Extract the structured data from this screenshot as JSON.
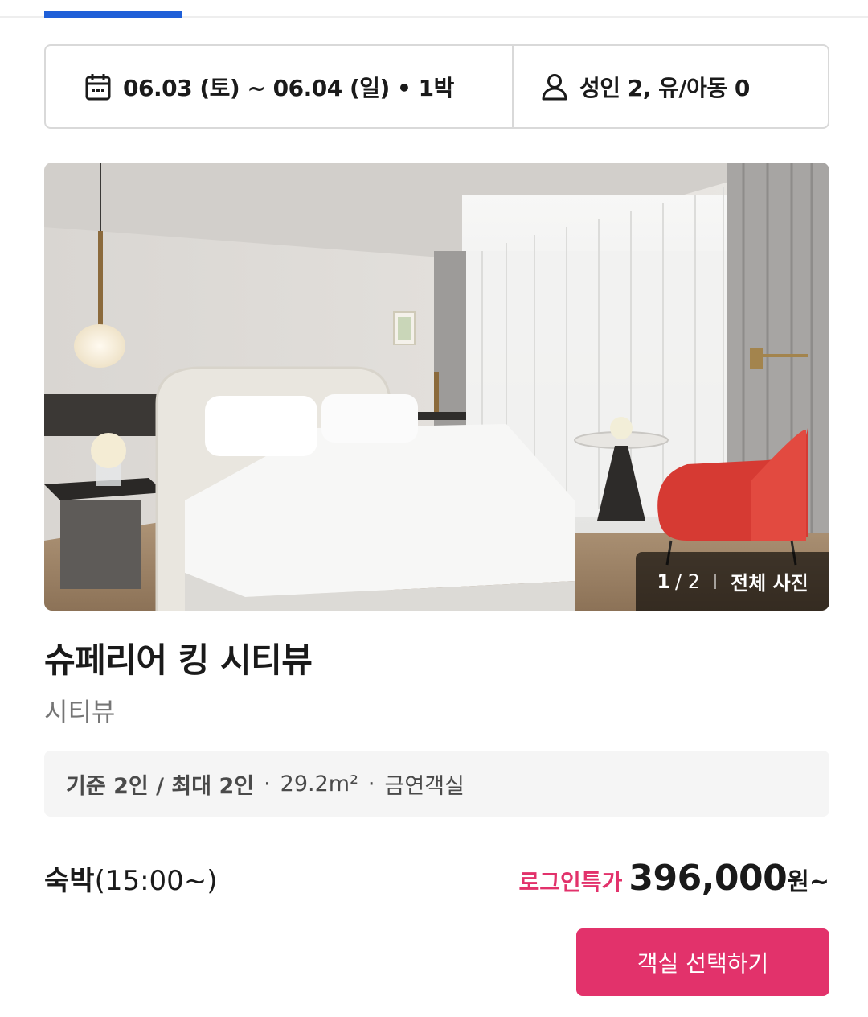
{
  "search": {
    "date_range": "06.03 (토) ~ 06.04 (일) • 1박",
    "guests": "성인 2, 유/아동 0",
    "date_icon": "calendar-icon",
    "guest_icon": "person-icon"
  },
  "photo": {
    "current": "1",
    "total": "/ 2",
    "all_photos_label": "전체 사진"
  },
  "room": {
    "title": "슈페리어 킹 시티뷰",
    "subtitle": "시티뷰",
    "capacity": "기준 2인 / 최대 2인",
    "size": "29.2m²",
    "smoking": "금연객실"
  },
  "stay": {
    "type": "숙박",
    "checkin": "(15:00~)"
  },
  "price": {
    "badge": "로그인특가",
    "amount": "396,000",
    "unit": "원~"
  },
  "cta": {
    "select_label": "객실 선택하기"
  },
  "colors": {
    "accent": "#e2326b",
    "tab_indicator": "#1f5fd8"
  }
}
